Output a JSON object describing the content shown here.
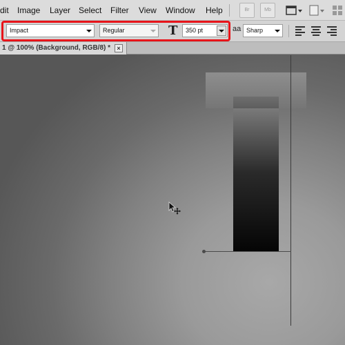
{
  "menubar": {
    "items": [
      "dit",
      "Image",
      "Layer",
      "Select",
      "Filter",
      "View",
      "Window",
      "Help"
    ],
    "right_buttons": [
      "Br",
      "Mb"
    ]
  },
  "options_bar": {
    "font_family": "Impact",
    "font_style": "Regular",
    "font_size": "350 pt",
    "antialias_label": "aa",
    "antialias": "Sharp",
    "highlight_color": "#e8141a"
  },
  "document": {
    "tab_title": "1 @ 100% (Background, RGB/8) *",
    "close_glyph": "×"
  },
  "icons": {
    "text_tool": "T",
    "align": [
      "align-left-icon",
      "align-center-icon",
      "align-right-icon"
    ]
  }
}
